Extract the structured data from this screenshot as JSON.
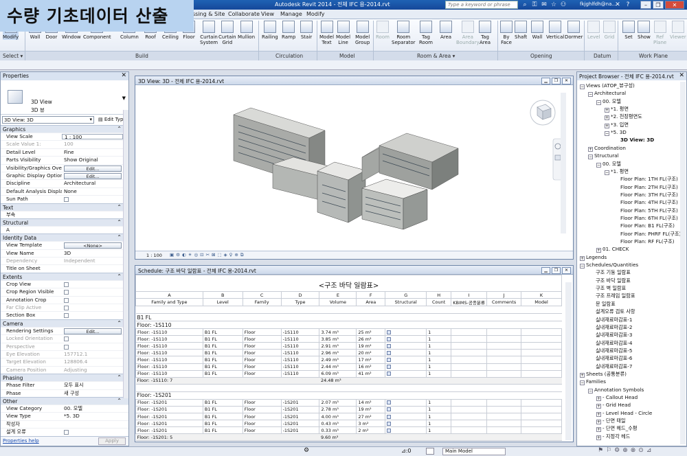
{
  "app": {
    "title": "Autodesk Revit 2014 -     전체 IFC 용-2014.rvt",
    "search_placeholder": "Type a keyword or phrase",
    "user": "fkjghlfdh@na...",
    "banner": "수량 기초데이터 산출"
  },
  "tabs": [
    "ssing & Site",
    "Collaborate",
    "View",
    "Manage",
    "Modify"
  ],
  "ribbon": {
    "buttons": [
      {
        "label": "Modify"
      },
      {
        "label": "Wall"
      },
      {
        "label": "Door"
      },
      {
        "label": "Window"
      },
      {
        "label": "Component"
      },
      {
        "label": "Column"
      },
      {
        "label": "Roof"
      },
      {
        "label": "Ceiling"
      },
      {
        "label": "Floor"
      },
      {
        "label": "Curtain\nSystem"
      },
      {
        "label": "Curtain\nGrid"
      },
      {
        "label": "Mullion"
      },
      {
        "label": "Railing"
      },
      {
        "label": "Ramp"
      },
      {
        "label": "Stair"
      },
      {
        "label": "Model\nText"
      },
      {
        "label": "Model\nLine"
      },
      {
        "label": "Model\nGroup"
      },
      {
        "label": "Room"
      },
      {
        "label": "Room\nSeparator"
      },
      {
        "label": "Tag\nRoom"
      },
      {
        "label": "Area"
      },
      {
        "label": "Area\nBoundary"
      },
      {
        "label": "Tag\nArea"
      },
      {
        "label": "By\nFace"
      },
      {
        "label": "Shaft"
      },
      {
        "label": "Wall"
      },
      {
        "label": "Vertical"
      },
      {
        "label": "Dormer"
      },
      {
        "label": "Level"
      },
      {
        "label": "Grid"
      },
      {
        "label": "Set"
      },
      {
        "label": "Show"
      },
      {
        "label": "Ref\nPlane"
      },
      {
        "label": "Viewer"
      }
    ],
    "panels": [
      "Select ▾",
      "Build",
      "Circulation",
      "Model",
      "Room & Area ▾",
      "Opening",
      "Datum",
      "Work Plane"
    ]
  },
  "properties": {
    "title": "Properties",
    "type_name": "3D View",
    "type_sub": "3D 뷰",
    "selector": "3D View: 3D",
    "edit_type": "Edit Type",
    "groups": [
      {
        "name": "Graphics",
        "rows": [
          {
            "k": "View Scale",
            "v": "1 : 100",
            "box": true
          },
          {
            "k": "Scale Value    1:",
            "v": "100",
            "dis": true
          },
          {
            "k": "Detail Level",
            "v": "Fine"
          },
          {
            "k": "Parts Visibility",
            "v": "Show Original"
          },
          {
            "k": "Visibility/Graphics Ove...",
            "btn": "Edit..."
          },
          {
            "k": "Graphic Display Options",
            "btn": "Edit..."
          },
          {
            "k": "Discipline",
            "v": "Architectural"
          },
          {
            "k": "Default Analysis Displa...",
            "v": "None"
          },
          {
            "k": "Sun Path",
            "cb": true
          }
        ]
      },
      {
        "name": "Text",
        "rows": [
          {
            "k": "부속",
            "v": ""
          }
        ]
      },
      {
        "name": "Structural",
        "rows": [
          {
            "k": "A",
            "v": ""
          }
        ]
      },
      {
        "name": "Identity Data",
        "rows": [
          {
            "k": "View Template",
            "btn": "<None>"
          },
          {
            "k": "View Name",
            "v": "3D"
          },
          {
            "k": "Dependency",
            "v": "Independent",
            "dis": true
          },
          {
            "k": "Title on Sheet",
            "v": ""
          }
        ]
      },
      {
        "name": "Extents",
        "rows": [
          {
            "k": "Crop View",
            "cb": true
          },
          {
            "k": "Crop Region Visible",
            "cb": true
          },
          {
            "k": "Annotation Crop",
            "cb": true
          },
          {
            "k": "Far Clip Active",
            "cb": true,
            "dis": true
          },
          {
            "k": "Section Box",
            "cb": true
          }
        ]
      },
      {
        "name": "Camera",
        "rows": [
          {
            "k": "Rendering Settings",
            "btn": "Edit..."
          },
          {
            "k": "Locked Orientation",
            "cb": true,
            "dis": true
          },
          {
            "k": "Perspective",
            "cb": true,
            "dis": true
          },
          {
            "k": "Eye Elevation",
            "v": "157712.1",
            "dis": true
          },
          {
            "k": "Target Elevation",
            "v": "128806.4",
            "dis": true
          },
          {
            "k": "Camera Position",
            "v": "Adjusting",
            "dis": true
          }
        ]
      },
      {
        "name": "Phasing",
        "rows": [
          {
            "k": "Phase Filter",
            "v": "모두 표시"
          },
          {
            "k": "Phase",
            "v": "새 구성"
          }
        ]
      },
      {
        "name": "Other",
        "rows": [
          {
            "k": "View Category",
            "v": "00. 모델"
          },
          {
            "k": "View Type",
            "v": "*5. 3D"
          },
          {
            "k": "작성자",
            "v": ""
          },
          {
            "k": "설계 오류",
            "cb": true
          }
        ]
      }
    ],
    "help": "Properties help",
    "apply": "Apply"
  },
  "view3d": {
    "title": "3D View: 3D - 전체 IFC 용-2014.rvt",
    "scale": "1 : 100"
  },
  "schedule": {
    "title": "Schedule: 구조 바닥 일람표 - 전체 IFC 용-2014.rvt",
    "heading": "<구조 바닥 일람표>",
    "letters": [
      "A",
      "B",
      "C",
      "D",
      "E",
      "F",
      "G",
      "H",
      "I",
      "J",
      "K"
    ],
    "columns": [
      "Family and Type",
      "Level",
      "Family",
      "Type",
      "Volume",
      "Area",
      "Structural",
      "Count",
      "KBIMS-공종분류",
      "Comments",
      "Model"
    ],
    "groups": [
      {
        "header": "B1 FL",
        "type": "Floor: -1S110",
        "rows": [
          [
            "Floor: -1S110",
            "B1 FL",
            "Floor",
            "-1S110",
            "3.74 m³",
            "25 m²",
            "1"
          ],
          [
            "Floor: -1S110",
            "B1 FL",
            "Floor",
            "-1S110",
            "3.85 m³",
            "26 m²",
            "1"
          ],
          [
            "Floor: -1S110",
            "B1 FL",
            "Floor",
            "-1S110",
            "2.91 m³",
            "19 m²",
            "1"
          ],
          [
            "Floor: -1S110",
            "B1 FL",
            "Floor",
            "-1S110",
            "2.96 m³",
            "20 m²",
            "1"
          ],
          [
            "Floor: -1S110",
            "B1 FL",
            "Floor",
            "-1S110",
            "2.49 m³",
            "17 m²",
            "1"
          ],
          [
            "Floor: -1S110",
            "B1 FL",
            "Floor",
            "-1S110",
            "2.44 m³",
            "16 m²",
            "1"
          ],
          [
            "Floor: -1S110",
            "B1 FL",
            "Floor",
            "-1S110",
            "6.09 m³",
            "41 m²",
            "1"
          ]
        ],
        "subtotal": "Floor: -1S110: 7",
        "subtotal_vol": "24.48 m³"
      },
      {
        "header": "",
        "type": "Floor: -1S201",
        "rows": [
          [
            "Floor: -1S201",
            "B1 FL",
            "Floor",
            "-1S201",
            "2.07 m³",
            "14 m²",
            "1"
          ],
          [
            "Floor: -1S201",
            "B1 FL",
            "Floor",
            "-1S201",
            "2.78 m³",
            "19 m²",
            "1"
          ],
          [
            "Floor: -1S201",
            "B1 FL",
            "Floor",
            "-1S201",
            "4.00 m³",
            "27 m²",
            "1"
          ],
          [
            "Floor: -1S201",
            "B1 FL",
            "Floor",
            "-1S201",
            "0.43 m³",
            "3 m²",
            "1"
          ],
          [
            "Floor: -1S201",
            "B1 FL",
            "Floor",
            "-1S201",
            "0.33 m³",
            "2 m²",
            "1"
          ]
        ],
        "subtotal": "Floor: -1S201: 5",
        "subtotal_vol": "9.60 m³"
      }
    ]
  },
  "browser": {
    "title": "Project Browser - 전체 IFC 용-2014.rvt",
    "nodes": [
      {
        "d": 0,
        "t": "−",
        "label": "Views (ATOP_뷰구성)"
      },
      {
        "d": 1,
        "t": "−",
        "label": "Architectural"
      },
      {
        "d": 2,
        "t": "−",
        "label": "00. 모델"
      },
      {
        "d": 3,
        "t": "+",
        "label": "*1. 평면"
      },
      {
        "d": 3,
        "t": "+",
        "label": "*2. 천장평면도"
      },
      {
        "d": 3,
        "t": "+",
        "label": "*3. 입면"
      },
      {
        "d": 3,
        "t": "−",
        "label": "*5. 3D"
      },
      {
        "d": 4,
        "t": "",
        "label": "3D View: 3D",
        "bold": true
      },
      {
        "d": 1,
        "t": "+",
        "label": "Coordination"
      },
      {
        "d": 1,
        "t": "−",
        "label": "Structural"
      },
      {
        "d": 2,
        "t": "−",
        "label": "00. 모델"
      },
      {
        "d": 3,
        "t": "−",
        "label": "*1. 평면"
      },
      {
        "d": 4,
        "t": "",
        "label": "Floor Plan: 1TH FL(구조)"
      },
      {
        "d": 4,
        "t": "",
        "label": "Floor Plan: 2TH FL(구조)"
      },
      {
        "d": 4,
        "t": "",
        "label": "Floor Plan: 3TH FL(구조)"
      },
      {
        "d": 4,
        "t": "",
        "label": "Floor Plan: 4TH FL(구조)"
      },
      {
        "d": 4,
        "t": "",
        "label": "Floor Plan: 5TH FL(구조)"
      },
      {
        "d": 4,
        "t": "",
        "label": "Floor Plan: 6TH FL(구조)"
      },
      {
        "d": 4,
        "t": "",
        "label": "Floor Plan: B1 FL(구조)"
      },
      {
        "d": 4,
        "t": "",
        "label": "Floor Plan: PHRF FL(구조)"
      },
      {
        "d": 4,
        "t": "",
        "label": "Floor Plan: RF FL(구조)"
      },
      {
        "d": 2,
        "t": "+",
        "label": "01. CHECK"
      },
      {
        "d": 0,
        "t": "+",
        "label": "Legends"
      },
      {
        "d": 0,
        "t": "−",
        "label": "Schedules/Quantities"
      },
      {
        "d": 1,
        "t": "",
        "label": "구조 기둥 일람표"
      },
      {
        "d": 1,
        "t": "",
        "label": "구조 바닥 일람표"
      },
      {
        "d": 1,
        "t": "",
        "label": "구조 벽 일람표"
      },
      {
        "d": 1,
        "t": "",
        "label": "구조 프레임 일람표"
      },
      {
        "d": 1,
        "t": "",
        "label": "문 일람표"
      },
      {
        "d": 1,
        "t": "",
        "label": "설계오류 검토 사항"
      },
      {
        "d": 1,
        "t": "",
        "label": "실내재료마감표-1"
      },
      {
        "d": 1,
        "t": "",
        "label": "실내재료마감표-2"
      },
      {
        "d": 1,
        "t": "",
        "label": "실내재료마감표-3"
      },
      {
        "d": 1,
        "t": "",
        "label": "실내재료마감표-4"
      },
      {
        "d": 1,
        "t": "",
        "label": "실내재료마감표-5"
      },
      {
        "d": 1,
        "t": "",
        "label": "실내재료마감표-6"
      },
      {
        "d": 1,
        "t": "",
        "label": "실내재료마감표-7"
      },
      {
        "d": 0,
        "t": "+",
        "label": "Sheets (공통분류)"
      },
      {
        "d": 0,
        "t": "−",
        "label": "Families"
      },
      {
        "d": 1,
        "t": "−",
        "label": "Annotation Symbols"
      },
      {
        "d": 2,
        "t": "+",
        "label": "- Callout Head"
      },
      {
        "d": 2,
        "t": "+",
        "label": "- Grid Head"
      },
      {
        "d": 2,
        "t": "+",
        "label": "- Level Head - Circle"
      },
      {
        "d": 2,
        "t": "+",
        "label": "- 단면 태일"
      },
      {
        "d": 2,
        "t": "+",
        "label": "- 단면 헤드_수평"
      },
      {
        "d": 2,
        "t": "+",
        "label": "- 지정각 헤드"
      }
    ]
  },
  "status": {
    "sel": ":0",
    "model": "Main Model"
  }
}
